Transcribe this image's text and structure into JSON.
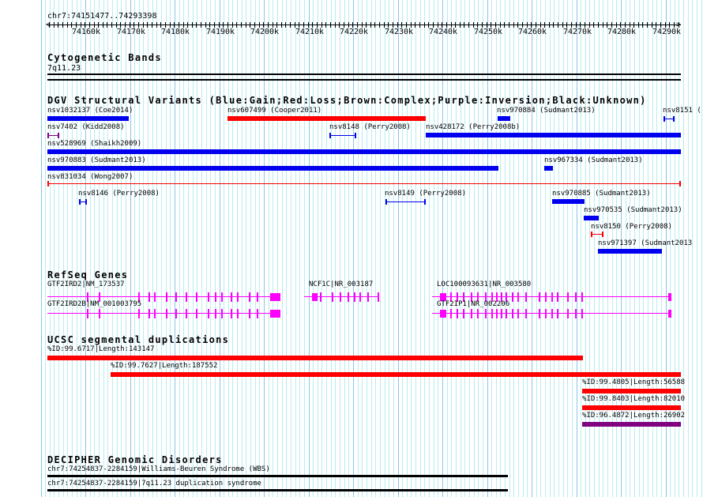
{
  "ruler": {
    "range": "chr7:74151477..74293398",
    "ticks": [
      "74160k",
      "74170k",
      "74180k",
      "74190k",
      "74200k",
      "74210k",
      "74220k",
      "74230k",
      "74240k",
      "74250k",
      "74260k",
      "74270k",
      "74280k",
      "74290k"
    ]
  },
  "cyto": {
    "title": "Cytogenetic Bands",
    "band": "7q11.23"
  },
  "dgv": {
    "title": "DGV Structural Variants (Blue:Gain;Red:Loss;Brown:Complex;Purple:Inversion;Black:Unknown)",
    "items": [
      "nsv1032137 (Coe2014)",
      "nsv607499 (Cooper2011)",
      "nsv970884 (Sudmant2013)",
      "nsv8151 (",
      "nsv7402 (Kidd2008)",
      "nsv8148 (Perry2008)",
      "nsv428172 (Perry2008b)",
      "nsv528969 (Shaikh2009)",
      "nsv970883 (Sudmant2013)",
      "nsv967334 (Sudmant2013)",
      "nsv831034 (Wong2007)",
      "nsv8146 (Perry2008)",
      "nsv8149 (Perry2008)",
      "nsv970885 (Sudmant2013)",
      "nsv970535 (Sudmant2013)",
      "nsv8150 (Perry2008)",
      "nsv971397 (Sudmant2013"
    ]
  },
  "refseq": {
    "title": "RefSeq Genes",
    "genes": [
      "GTF2IRD2|NM_173537",
      "NCF1C|NR_003187",
      "LOC100093631|NR_003580",
      "GTF2IRD2B|NM_001003795",
      "GTF2IP1|NR_002206"
    ]
  },
  "segdup": {
    "title": "UCSC segmental duplications",
    "items": [
      "%ID:99.6717|Length:143147",
      "%ID:99.7627|Length:187552",
      "%ID:99.4805|Length:56588",
      "%ID:99.8403|Length:82010",
      "%ID:96.4872|Length:26902"
    ]
  },
  "decipher": {
    "title": "DECIPHER Genomic Disorders",
    "items": [
      "chr7:74254837-2284159|Williams-Beuren Syndrome (WBS)",
      "chr7:74254837-2284159|7q11.23 duplication syndrome"
    ]
  },
  "colors": {
    "gain": "#0000ee",
    "loss": "#ff0000",
    "inversion": "#800080",
    "gene": "#ff00ff"
  }
}
